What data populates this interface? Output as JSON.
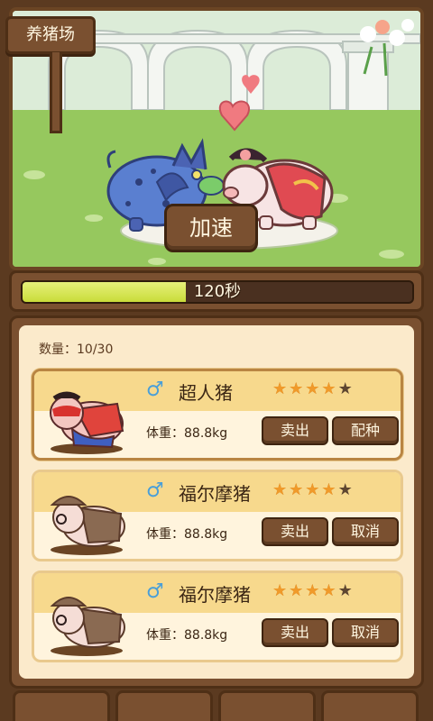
{
  "scene": {
    "sign_label": "养猪场",
    "speed_button": "加速"
  },
  "timer": {
    "text": "120秒",
    "progress": 0.42
  },
  "list": {
    "count": "数量：10/30",
    "pigs": [
      {
        "gender": "♂",
        "name": "超人猪",
        "stars": 4,
        "max_stars": 5,
        "weight": "体重：88.8kg",
        "sell_label": "卖出",
        "action_label": "配种",
        "selected": true
      },
      {
        "gender": "♂",
        "name": "福尔摩猪",
        "stars": 4,
        "max_stars": 5,
        "weight": "体重：88.8kg",
        "sell_label": "卖出",
        "action_label": "取消",
        "selected": false
      },
      {
        "gender": "♂",
        "name": "福尔摩猪",
        "stars": 4,
        "max_stars": 5,
        "weight": "体重：88.8kg",
        "sell_label": "卖出",
        "action_label": "取消",
        "selected": false
      }
    ]
  },
  "colors": {
    "wood": "#7a5030",
    "wood_dark": "#4e2f16",
    "panel": "#fbeacb",
    "star_on": "#f09a2a",
    "star_off": "#5e4630",
    "gender_male": "#4a9fd8",
    "progress": "#d6e34a"
  }
}
